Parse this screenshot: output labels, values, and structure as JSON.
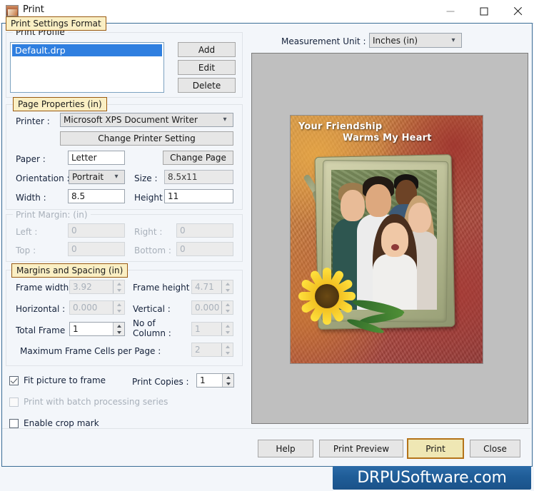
{
  "window": {
    "title": "Print",
    "icon": "app-photo-icon",
    "minimize_label": "—",
    "maximize_label": "□",
    "close_label": "×"
  },
  "tab": {
    "label": "Print Settings Format"
  },
  "print_profile": {
    "group_label": "Print Profile",
    "items": [
      "Default.drp"
    ],
    "selected": "Default.drp",
    "buttons": {
      "add": "Add",
      "edit": "Edit",
      "delete": "Delete"
    }
  },
  "page_properties": {
    "group_label": "Page Properties  (in)",
    "printer_label": "Printer :",
    "printer_value": "Microsoft XPS Document Writer",
    "change_printer_setting": "Change Printer Setting",
    "paper_label": "Paper :",
    "paper_value": "Letter",
    "change_page": "Change Page",
    "orientation_label": "Orientation :",
    "orientation_value": "Portrait",
    "size_label": "Size :",
    "size_value": "8.5x11",
    "width_label": "Width :",
    "width_value": "8.5",
    "height_label": "Height :",
    "height_value": "11"
  },
  "print_margin": {
    "group_label": "Print Margin: (in)",
    "left_label": "Left :",
    "left_value": "0",
    "right_label": "Right :",
    "right_value": "0",
    "top_label": "Top :",
    "top_value": "0",
    "bottom_label": "Bottom :",
    "bottom_value": "0"
  },
  "margins_spacing": {
    "group_label": "Margins and Spacing  (in)",
    "frame_width_label": "Frame width",
    "frame_width_value": "3.92",
    "frame_height_label": "Frame height :",
    "frame_height_value": "4.71",
    "horizontal_label": "Horizontal :",
    "horizontal_value": "0.000",
    "vertical_label": "Vertical :",
    "vertical_value": "0.000",
    "total_frame_label": "Total Frame",
    "total_frame_value": "1",
    "no_of_column_label": "No of Column :",
    "no_of_column_value": "1",
    "max_cells_label": "Maximum Frame Cells per Page :",
    "max_cells_value": "2"
  },
  "options": {
    "fit_picture_label": "Fit picture to frame",
    "fit_picture_checked": true,
    "batch_label": "Print with batch processing series",
    "batch_checked": false,
    "crop_mark_label": "Enable crop mark",
    "crop_mark_checked": false,
    "print_copies_label": "Print Copies :",
    "print_copies_value": "1"
  },
  "measurement": {
    "label": "Measurement Unit :",
    "value": "Inches (in)"
  },
  "preview": {
    "card_title_line1": "Your Friendship",
    "card_title_line2": "Warms My Heart"
  },
  "footer": {
    "help": "Help",
    "print_preview": "Print Preview",
    "print": "Print",
    "close": "Close"
  },
  "watermark": {
    "text": "DRPUSoftware.com"
  },
  "colors": {
    "accent_tab_bg": "#faefc4",
    "accent_tab_border": "#9a5a10",
    "selection_blue": "#2f7fe0",
    "dialog_border": "#3b6d96",
    "watermark_blue": "#1f5d98"
  }
}
